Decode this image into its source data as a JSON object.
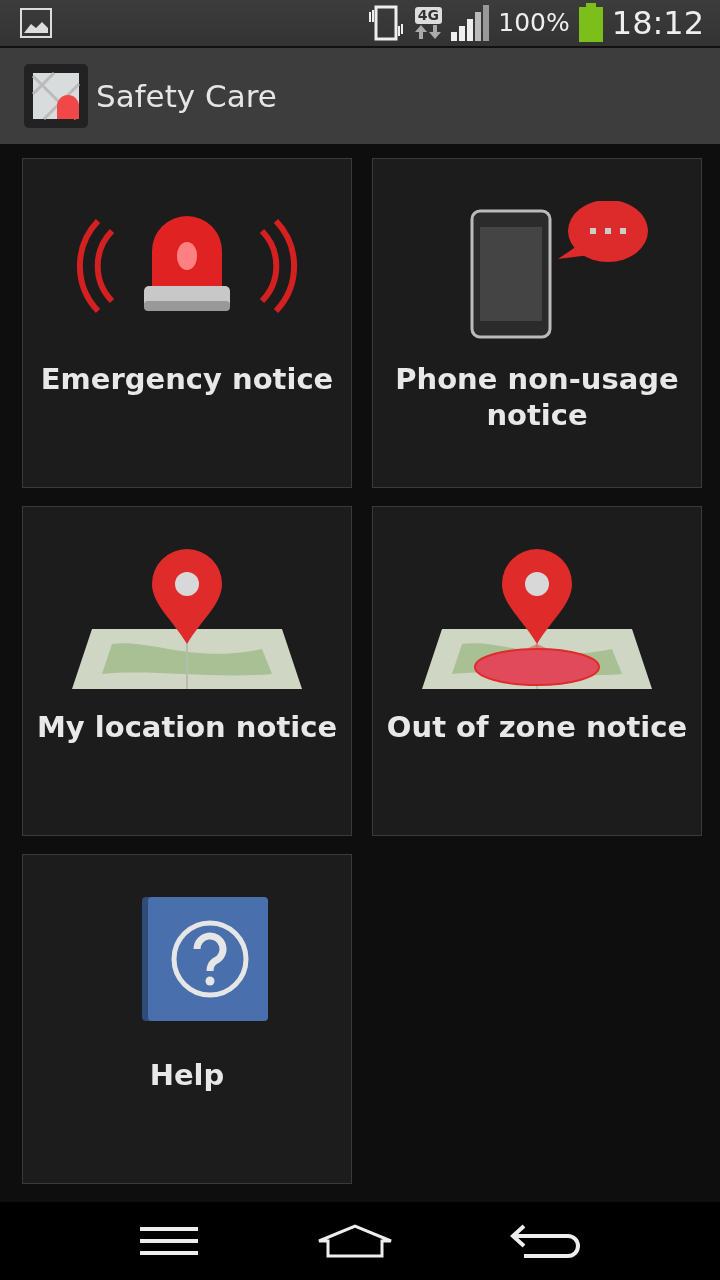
{
  "status_bar": {
    "network": "4G",
    "battery": "100%",
    "time": "18:12"
  },
  "app_bar": {
    "title": "Safety Care"
  },
  "tiles": [
    {
      "kind": "siren",
      "label": "Emergency notice"
    },
    {
      "kind": "phone",
      "label": "Phone non-usage notice"
    },
    {
      "kind": "location",
      "label": "My location notice"
    },
    {
      "kind": "zone",
      "label": "Out of zone notice"
    },
    {
      "kind": "help",
      "label": "Help"
    }
  ]
}
